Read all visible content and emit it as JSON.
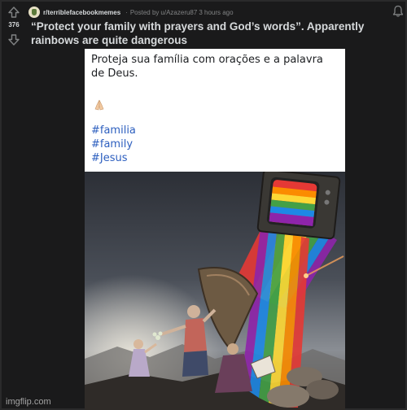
{
  "post": {
    "score": "376",
    "subreddit": "r/terriblefacebookmemes",
    "posted_by_prefix": "Posted by",
    "author": "u/Azazeru87",
    "time": "3 hours ago",
    "title": "“Protect your family with prayers and God’s words”. Apparently rainbows are quite dangerous"
  },
  "facebook_post": {
    "text": "Proteja sua família com orações e a palavra de Deus.",
    "emoji": "folded-hands",
    "hashtags": [
      "#familia",
      "#family",
      "#Jesus"
    ]
  },
  "watermark": "imgflip.com",
  "colors": {
    "page_bg": "#1a1a1b",
    "text_primary": "#d7dadc",
    "text_meta": "#818384",
    "hashtag": "#2d5fbf"
  }
}
